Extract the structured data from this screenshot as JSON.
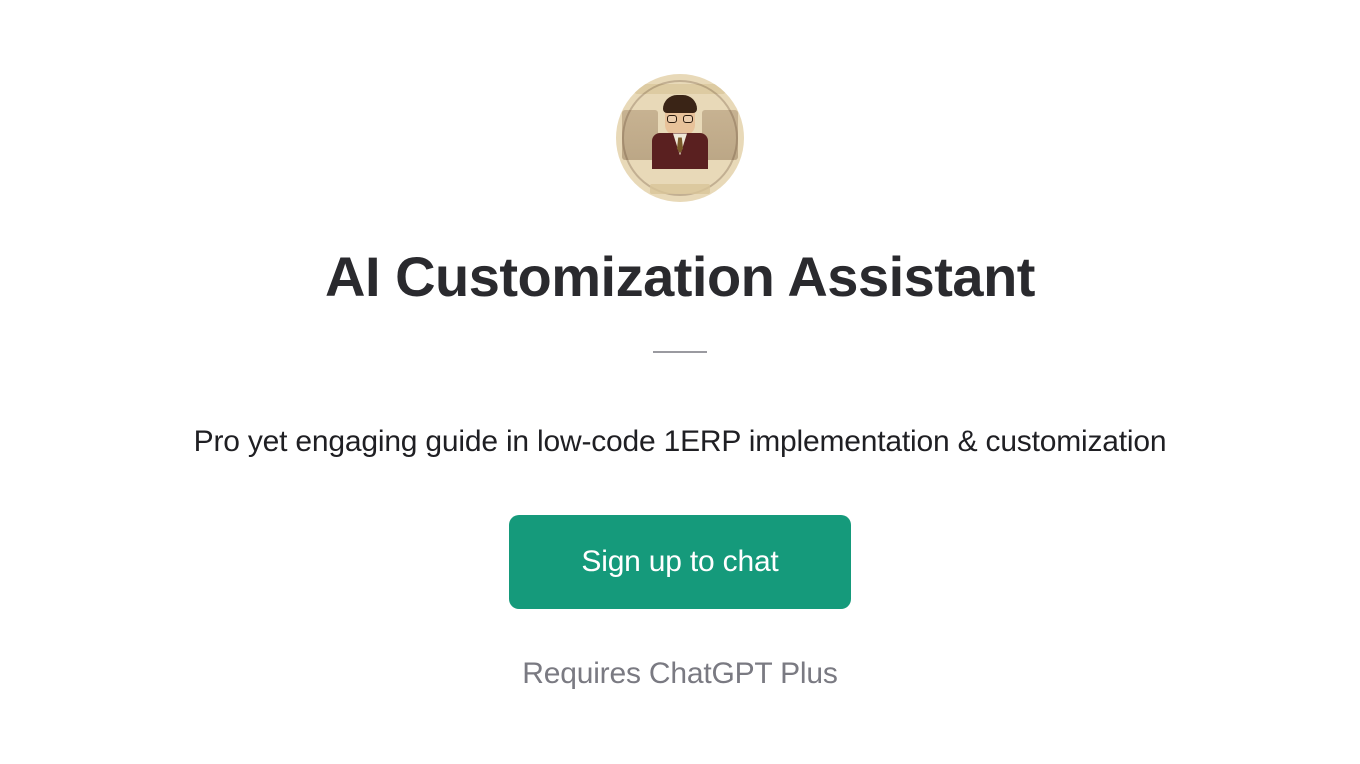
{
  "page": {
    "title": "AI Customization Assistant",
    "description": "Pro yet engaging guide in low-code 1ERP implementation & customization",
    "cta_label": "Sign up to chat",
    "footnote": "Requires ChatGPT Plus"
  },
  "avatar": {
    "semantic": "assistant-profile-avatar"
  },
  "colors": {
    "accent": "#159a7b",
    "text_primary": "#2a2a2e",
    "text_muted": "#7a7a82"
  }
}
